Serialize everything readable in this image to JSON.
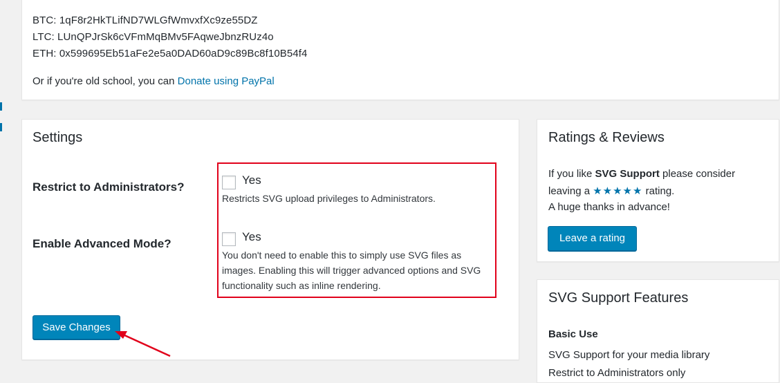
{
  "donate": {
    "btc": "BTC: 1qF8r2HkTLifND7WLGfWmvxfXc9ze55DZ",
    "ltc": "LTC: LUnQPJrSk6cVFmMqBMv5FAqweJbnzRUz4o",
    "eth": "ETH: 0x599695Eb51aFe2e5a0DAD60aD9c89Bc8f10B54f4",
    "old_school_text": "Or if you're old school, you can ",
    "paypal_link": "Donate using PayPal"
  },
  "settings": {
    "title": "Settings",
    "rows": [
      {
        "label": "Restrict to Administrators?",
        "checkbox_label": "Yes",
        "checked": false,
        "description": "Restricts SVG upload privileges to Administrators."
      },
      {
        "label": "Enable Advanced Mode?",
        "checkbox_label": "Yes",
        "checked": false,
        "description_lines": [
          "You don't need to enable this to simply use SVG files as",
          "images. Enabling this will trigger advanced options and SVG",
          "functionality such as inline rendering."
        ]
      }
    ],
    "save_label": "Save Changes"
  },
  "ratings": {
    "title": "Ratings & Reviews",
    "line1_prefix": "If you like ",
    "line1_bold": "SVG Support",
    "line1_suffix": " please consider",
    "line2_prefix": "leaving a ",
    "stars": "★★★★★",
    "line2_suffix": " rating.",
    "line3": "A huge thanks in advance!",
    "button_label": "Leave a rating"
  },
  "features": {
    "title": "SVG Support Features",
    "heading": "Basic Use",
    "items": [
      "SVG Support for your media library",
      "Restrict to Administrators only"
    ]
  },
  "colors": {
    "accent": "#0073aa",
    "button": "#0085ba",
    "highlight_border": "#e1001a",
    "arrow": "#e1001a"
  }
}
